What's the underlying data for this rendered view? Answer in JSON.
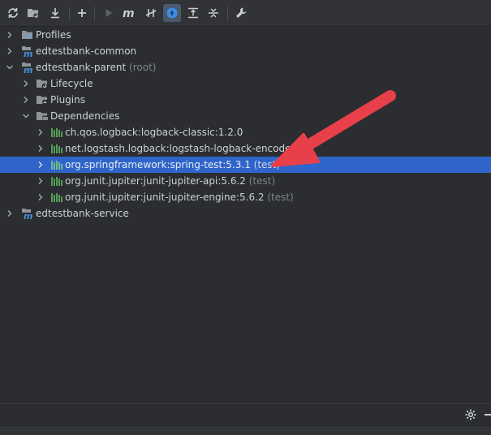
{
  "toolbar": {
    "buttons": [
      {
        "icon": "reload-icon"
      },
      {
        "icon": "add-folder-icon"
      },
      {
        "icon": "download-icon"
      },
      {
        "icon": "plus-icon"
      },
      {
        "icon": "run-icon"
      },
      {
        "icon": "maven-m-icon"
      },
      {
        "icon": "skip-tests-icon"
      },
      {
        "icon": "offline-lightning-icon"
      },
      {
        "icon": "show-dependencies-icon"
      },
      {
        "icon": "collapse-all-icon"
      },
      {
        "icon": "settings-wrench-icon"
      }
    ]
  },
  "tree": {
    "items": [
      {
        "label": "Profiles",
        "suffix": "",
        "icon": "profiles-icon"
      },
      {
        "label": "edtestbank-common",
        "suffix": "",
        "icon": "maven-module-icon"
      },
      {
        "label": "edtestbank-parent",
        "suffix": " (root)",
        "icon": "maven-module-icon"
      },
      {
        "label": "Lifecycle",
        "suffix": "",
        "icon": "lifecycle-folder-icon"
      },
      {
        "label": "Plugins",
        "suffix": "",
        "icon": "plugins-folder-icon"
      },
      {
        "label": "Dependencies",
        "suffix": "",
        "icon": "dependencies-folder-icon"
      },
      {
        "label": "ch.qos.logback:logback-classic:1.2.0",
        "suffix": "",
        "icon": "library-icon"
      },
      {
        "label": "net.logstash.logback:logstash-logback-encoder:6.5",
        "suffix": "",
        "icon": "library-icon"
      },
      {
        "label": "org.springframework:spring-test:5.3.1",
        "suffix": " (test)",
        "icon": "library-icon"
      },
      {
        "label": "org.junit.jupiter:junit-jupiter-api:5.6.2",
        "suffix": " (test)",
        "icon": "library-icon"
      },
      {
        "label": "org.junit.jupiter:junit-jupiter-engine:5.6.2",
        "suffix": " (test)",
        "icon": "library-icon"
      },
      {
        "label": "edtestbank-service",
        "suffix": "",
        "icon": "maven-module-icon"
      }
    ]
  },
  "status_bar": {
    "icons": [
      "gear-icon",
      "minimize-icon"
    ]
  },
  "colors": {
    "background": "#2b2d30",
    "selection": "#2f65ca",
    "annotation_arrow": "#e8404a",
    "library_green": "#5fb865"
  }
}
